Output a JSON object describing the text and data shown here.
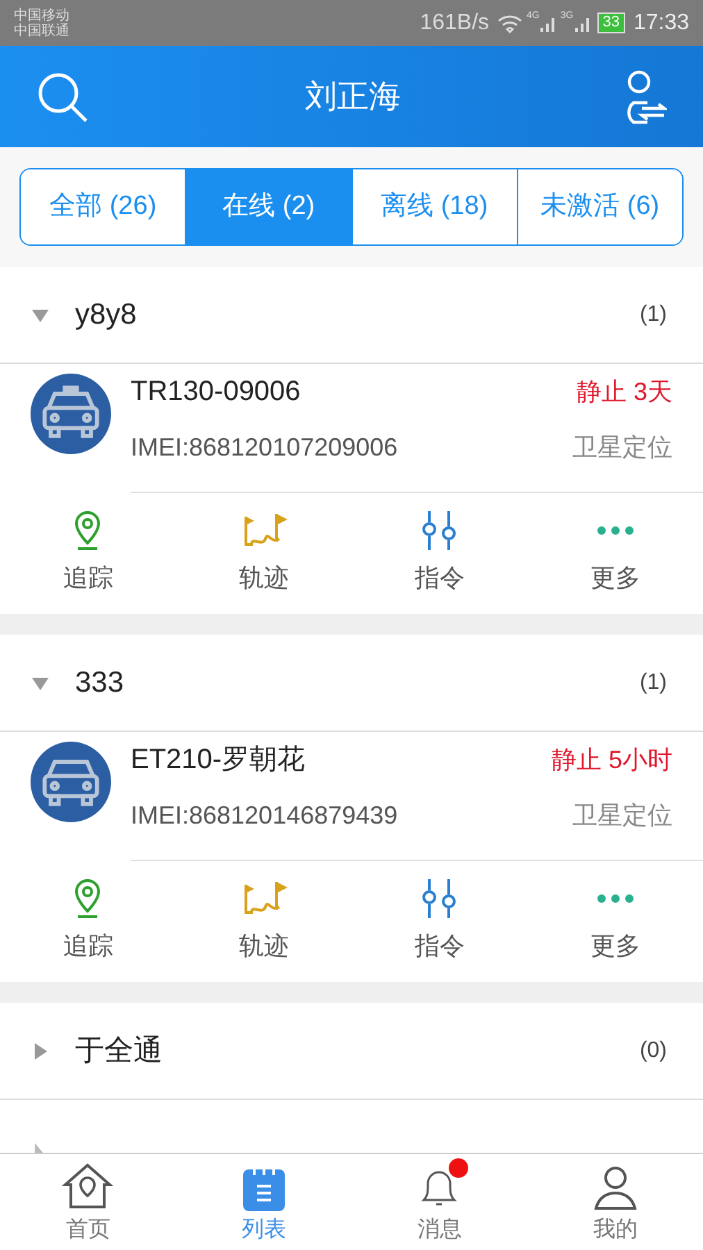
{
  "status_bar": {
    "carriers": [
      "中国移动",
      "中国联通"
    ],
    "speed": "161B/s",
    "network_1": "4G",
    "network_2": "3G",
    "battery": "33",
    "time": "17:33"
  },
  "header": {
    "title": "刘正海"
  },
  "tabs": [
    {
      "label": "全部 (26)",
      "selected": false
    },
    {
      "label": "在线 (2)",
      "selected": true
    },
    {
      "label": "离线 (18)",
      "selected": false
    },
    {
      "label": "未激活 (6)",
      "selected": false
    }
  ],
  "groups": [
    {
      "name": "y8y8",
      "count": "(1)",
      "expanded": true,
      "devices": [
        {
          "name": "TR130-09006",
          "status": "静止 3天",
          "imei": "IMEI:868120107209006",
          "location": "卫星定位",
          "kind": "police",
          "actions": [
            {
              "kind": "track",
              "label": "追踪"
            },
            {
              "kind": "history",
              "label": "轨迹"
            },
            {
              "kind": "command",
              "label": "指令"
            },
            {
              "kind": "more",
              "label": "更多"
            }
          ]
        }
      ]
    },
    {
      "name": "333",
      "count": "(1)",
      "expanded": true,
      "devices": [
        {
          "name": "ET210-罗朝花",
          "status": "静止 5小时",
          "imei": "IMEI:868120146879439",
          "location": "卫星定位",
          "kind": "car",
          "actions": [
            {
              "kind": "track",
              "label": "追踪"
            },
            {
              "kind": "history",
              "label": "轨迹"
            },
            {
              "kind": "command",
              "label": "指令"
            },
            {
              "kind": "more",
              "label": "更多"
            }
          ]
        }
      ]
    },
    {
      "name": "于全通",
      "count": "(0)",
      "expanded": false
    }
  ],
  "bottom_nav": [
    {
      "kind": "home",
      "label": "首页",
      "selected": false,
      "badge": false
    },
    {
      "kind": "list",
      "label": "列表",
      "selected": true,
      "badge": false
    },
    {
      "kind": "bell",
      "label": "消息",
      "selected": false,
      "badge": true
    },
    {
      "kind": "user",
      "label": "我的",
      "selected": false,
      "badge": false
    }
  ]
}
